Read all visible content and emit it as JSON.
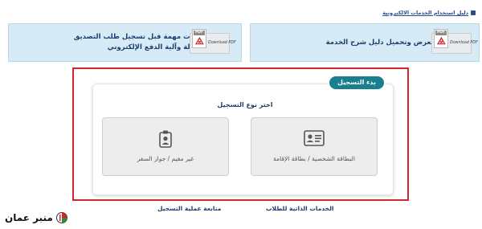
{
  "top_link": {
    "label": "دليل استخدام الخدمات الالكترونية"
  },
  "banners": [
    {
      "text": "اضغط هنا لعرض وتحميل دليل شرح الخدمة",
      "pdf_label": "Download PDF",
      "pdf_header": "PDF"
    },
    {
      "text_line1": "ملاحظات مهمة قبل تسجيل طلب التصديق",
      "text_line2": "والمعادلة وآلية الدفع الإلكتروني",
      "pdf_label": "Download PDF",
      "pdf_header": "PDF"
    }
  ],
  "registration": {
    "tag": "بدء التسجيل",
    "prompt": "اختر نوع التسجيل",
    "options": [
      {
        "label": "البطاقة الشخصية / بطاقة الإقامة",
        "icon": "id-card-icon"
      },
      {
        "label": "غير مقيم / جواز السفر",
        "icon": "passport-badge-icon"
      }
    ]
  },
  "bottom_links": {
    "student_services": "الخدمات الذاتية للطلاب",
    "track_registration": "متابعة عملية التسجيل"
  },
  "watermark": {
    "text": "منبر عمان"
  },
  "colors": {
    "accent_teal": "#197f8f",
    "frame_red": "#d4252c",
    "banner_bg": "#d6ebf6",
    "text_navy": "#1d3f6e"
  }
}
